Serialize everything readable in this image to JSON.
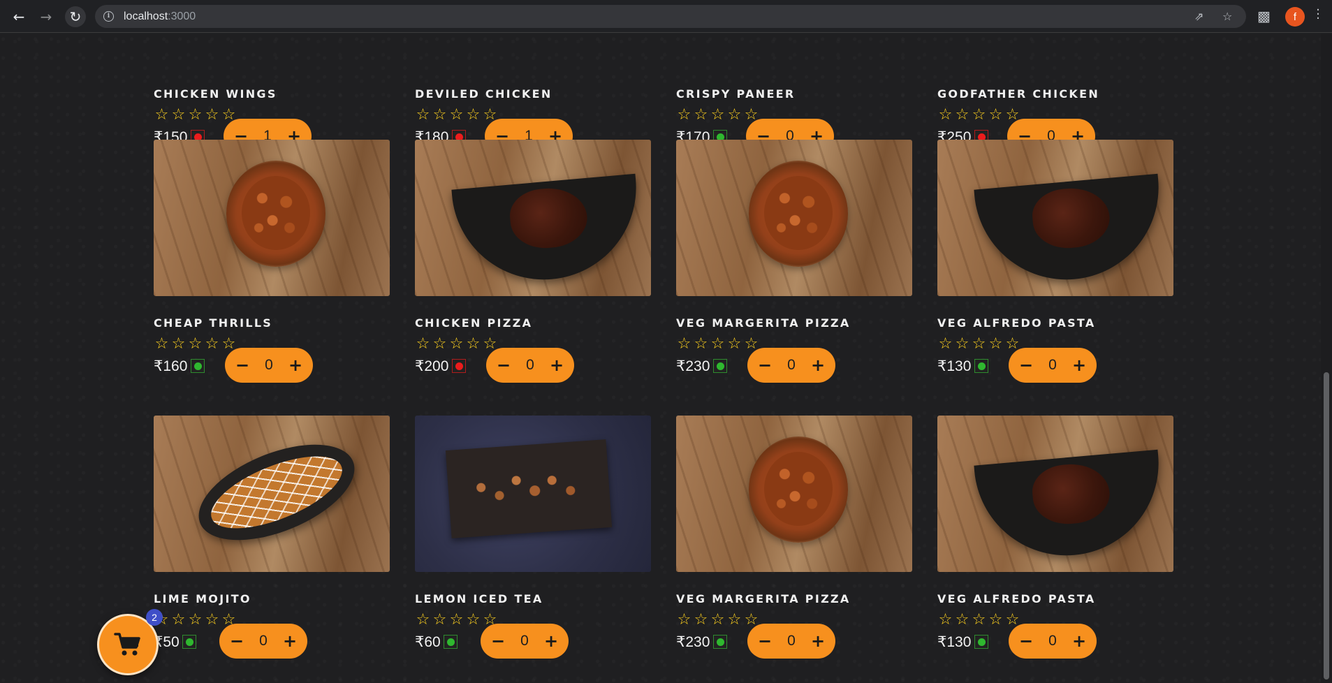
{
  "browser": {
    "url_host": "localhost",
    "url_port": ":3000",
    "profile_initial": "f"
  },
  "cart": {
    "count": "2"
  },
  "menu_items": [
    {
      "name": "CHICKEN WINGS",
      "price": "₹150",
      "veg": false,
      "qty": "1",
      "rating": 0,
      "photo": "none"
    },
    {
      "name": "DEVILED CHICKEN",
      "price": "₹180",
      "veg": false,
      "qty": "1",
      "rating": 0,
      "photo": "none"
    },
    {
      "name": "CRISPY PANEER",
      "price": "₹170",
      "veg": true,
      "qty": "0",
      "rating": 0,
      "photo": "none"
    },
    {
      "name": "GODFATHER CHICKEN",
      "price": "₹250",
      "veg": false,
      "qty": "0",
      "rating": 0,
      "photo": "none"
    },
    {
      "name": "CHEAP THRILLS",
      "price": "₹160",
      "veg": true,
      "qty": "0",
      "rating": 0,
      "photo": "bowl"
    },
    {
      "name": "CHICKEN PIZZA",
      "price": "₹200",
      "veg": false,
      "qty": "0",
      "rating": 0,
      "photo": "halfplate"
    },
    {
      "name": "VEG MARGERITA PIZZA",
      "price": "₹230",
      "veg": true,
      "qty": "0",
      "rating": 0,
      "photo": "bowl"
    },
    {
      "name": "VEG ALFREDO PASTA",
      "price": "₹130",
      "veg": true,
      "qty": "0",
      "rating": 0,
      "photo": "halfplate"
    },
    {
      "name": "LIME MOJITO",
      "price": "₹50",
      "veg": true,
      "qty": "0",
      "rating": 0,
      "photo": "boat"
    },
    {
      "name": "LEMON ICED TEA",
      "price": "₹60",
      "veg": true,
      "qty": "0",
      "rating": 0,
      "photo": "board"
    },
    {
      "name": "VEG MARGERITA PIZZA",
      "price": "₹230",
      "veg": true,
      "qty": "0",
      "rating": 0,
      "photo": "bowl"
    },
    {
      "name": "VEG ALFREDO PASTA",
      "price": "₹130",
      "veg": true,
      "qty": "0",
      "rating": 0,
      "photo": "halfplate"
    }
  ],
  "icons": {
    "back": "arrow-left-icon",
    "forward": "arrow-right-icon",
    "reload": "reload-icon",
    "site_info": "info-icon",
    "share": "share-icon",
    "bookmark": "star-outline-icon",
    "extensions": "puzzle-icon",
    "menu": "kebab-menu-icon",
    "cart": "cart-icon"
  },
  "colors": {
    "accent": "#f7901e",
    "star": "#ffd21f",
    "veg": "#2fb82f",
    "nonveg": "#ec1c1c",
    "badge": "#3f4fc8"
  }
}
